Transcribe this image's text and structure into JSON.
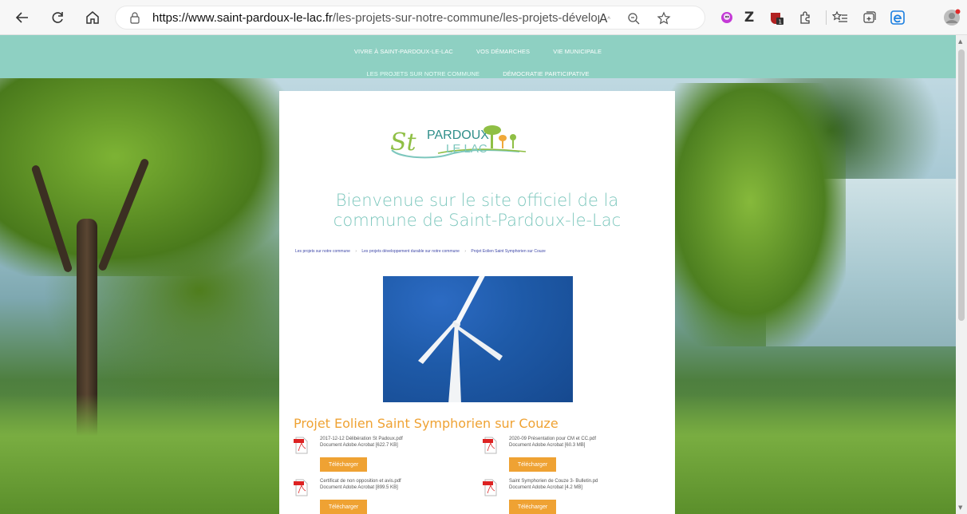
{
  "browser": {
    "url_domain": "https://www.saint-pardoux-le-lac.fr",
    "url_path": "/les-projets-sur-notre-commune/les-projets-dévelop...",
    "reader_icon": "read-aloud-icon",
    "zoom_icon": "zoom-icon",
    "favorite_icon": "favorite-star-icon",
    "extension_badge": "1"
  },
  "site_nav": {
    "row1": [
      "VIVRE À SAINT-PARDOUX-LE-LAC",
      "VOS DÉMARCHES",
      "VIE MUNICIPALE"
    ],
    "row2": [
      "LES PROJETS SUR NOTRE COMMUNE",
      "DÉMOCRATIE PARTICIPATIVE"
    ]
  },
  "logo": {
    "line1": "PARDOUX",
    "line2": "LE LAC",
    "initial": "St"
  },
  "welcome": {
    "line1": "Bienvenue sur le site officiel de la",
    "line2": "commune de Saint-Pardoux-le-Lac"
  },
  "breadcrumb": [
    "Les projets sur notre commune",
    "Les projets développement durable sur notre commune",
    "Projet Eolien Saint Symphorien sur Couze"
  ],
  "project_title": "Projet Eolien Saint Symphorien sur Couze",
  "documents": [
    {
      "name": "2017-12-12 Délibération St Padoux.pdf",
      "meta": "Document Adobe Acrobat [622.7 KB]",
      "button": "Télécharger"
    },
    {
      "name": "2020-09 Présentation pour CM et CC.pdf",
      "meta": "Document Adobe Acrobat [60.3 MB]",
      "button": "Télécharger"
    },
    {
      "name": "Certificat de non opposition et avis.pdf",
      "meta": "Document Adobe Acrobat [899.5 KB]",
      "button": "Télécharger"
    },
    {
      "name": "Saint Symphorien de Couze 3- Bulletin.pd",
      "meta": "Document Adobe Acrobat [4.2 MB]",
      "button": "Télécharger"
    }
  ],
  "colors": {
    "nav_bg": "#8ed0c2",
    "title_teal": "#7dc7bd",
    "accent_orange": "#efa233",
    "breadcrumb_blue": "#3f48a8"
  }
}
